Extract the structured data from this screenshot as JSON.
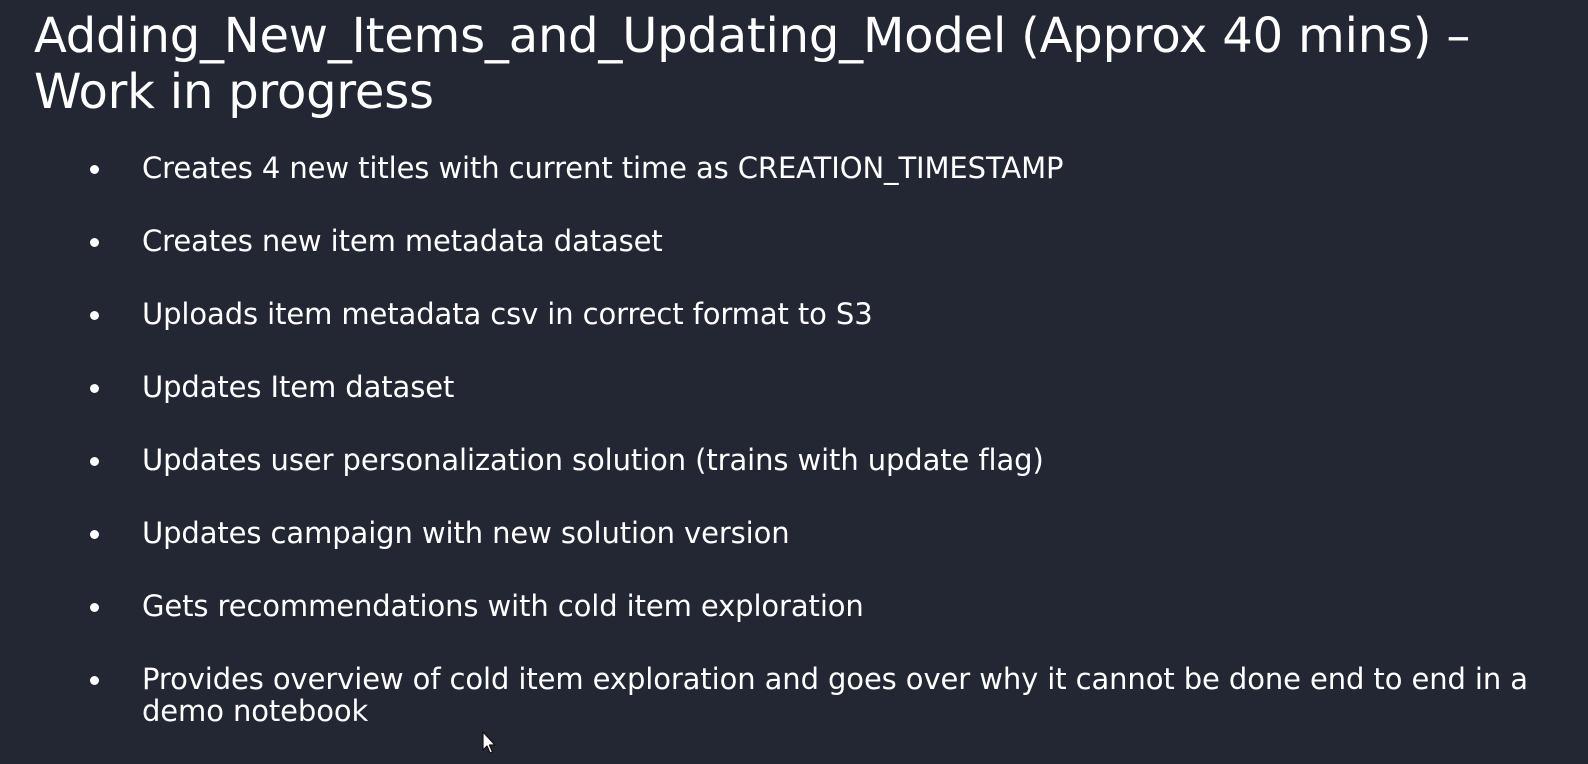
{
  "slide": {
    "title": "Adding_New_Items_and_Updating_Model (Approx 40 mins) – Work in progress",
    "bullets": [
      "Creates 4 new titles with current time as CREATION_TIMESTAMP",
      "Creates new item metadata dataset",
      "Uploads item metadata csv in correct format to S3",
      "Updates Item dataset",
      "Updates user personalization solution (trains with update flag)",
      "Updates campaign with new solution version",
      "Gets recommendations with cold item exploration",
      "Provides overview of cold item exploration and goes over why it cannot be done end to end in a demo notebook"
    ]
  },
  "cursor": {
    "icon": "mouse-pointer-icon"
  },
  "colors": {
    "background": "#232733",
    "text": "#ffffff"
  }
}
